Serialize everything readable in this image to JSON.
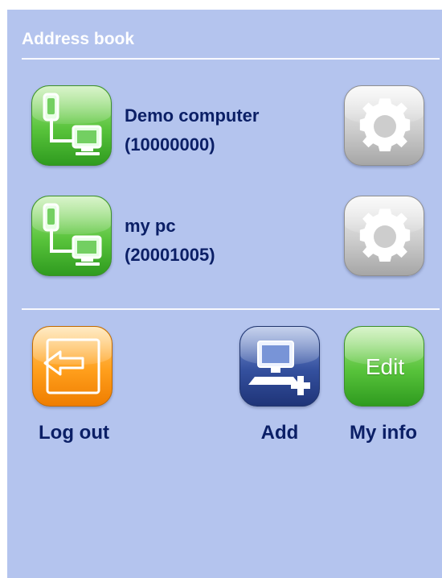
{
  "header": {
    "title": "Address book"
  },
  "contacts": [
    {
      "name": "Demo computer",
      "id": "(10000000)",
      "connect_icon": "phone-to-computer-icon",
      "settings_icon": "gear-icon"
    },
    {
      "name": "my pc",
      "id": "(20001005)",
      "connect_icon": "phone-to-computer-icon",
      "settings_icon": "gear-icon"
    }
  ],
  "actions": {
    "logout": {
      "label": "Log out",
      "icon": "logout-arrow-icon"
    },
    "add": {
      "label": "Add",
      "icon": "add-computer-icon"
    },
    "my_info": {
      "label": "My info",
      "button_text": "Edit"
    }
  },
  "colors": {
    "background": "#b4c4ee",
    "text": "#0b1f66",
    "green_button": "#58c33b",
    "gray_button": "#cdcdcd",
    "orange_button": "#ff9f1c",
    "blue_button": "#34509e"
  }
}
